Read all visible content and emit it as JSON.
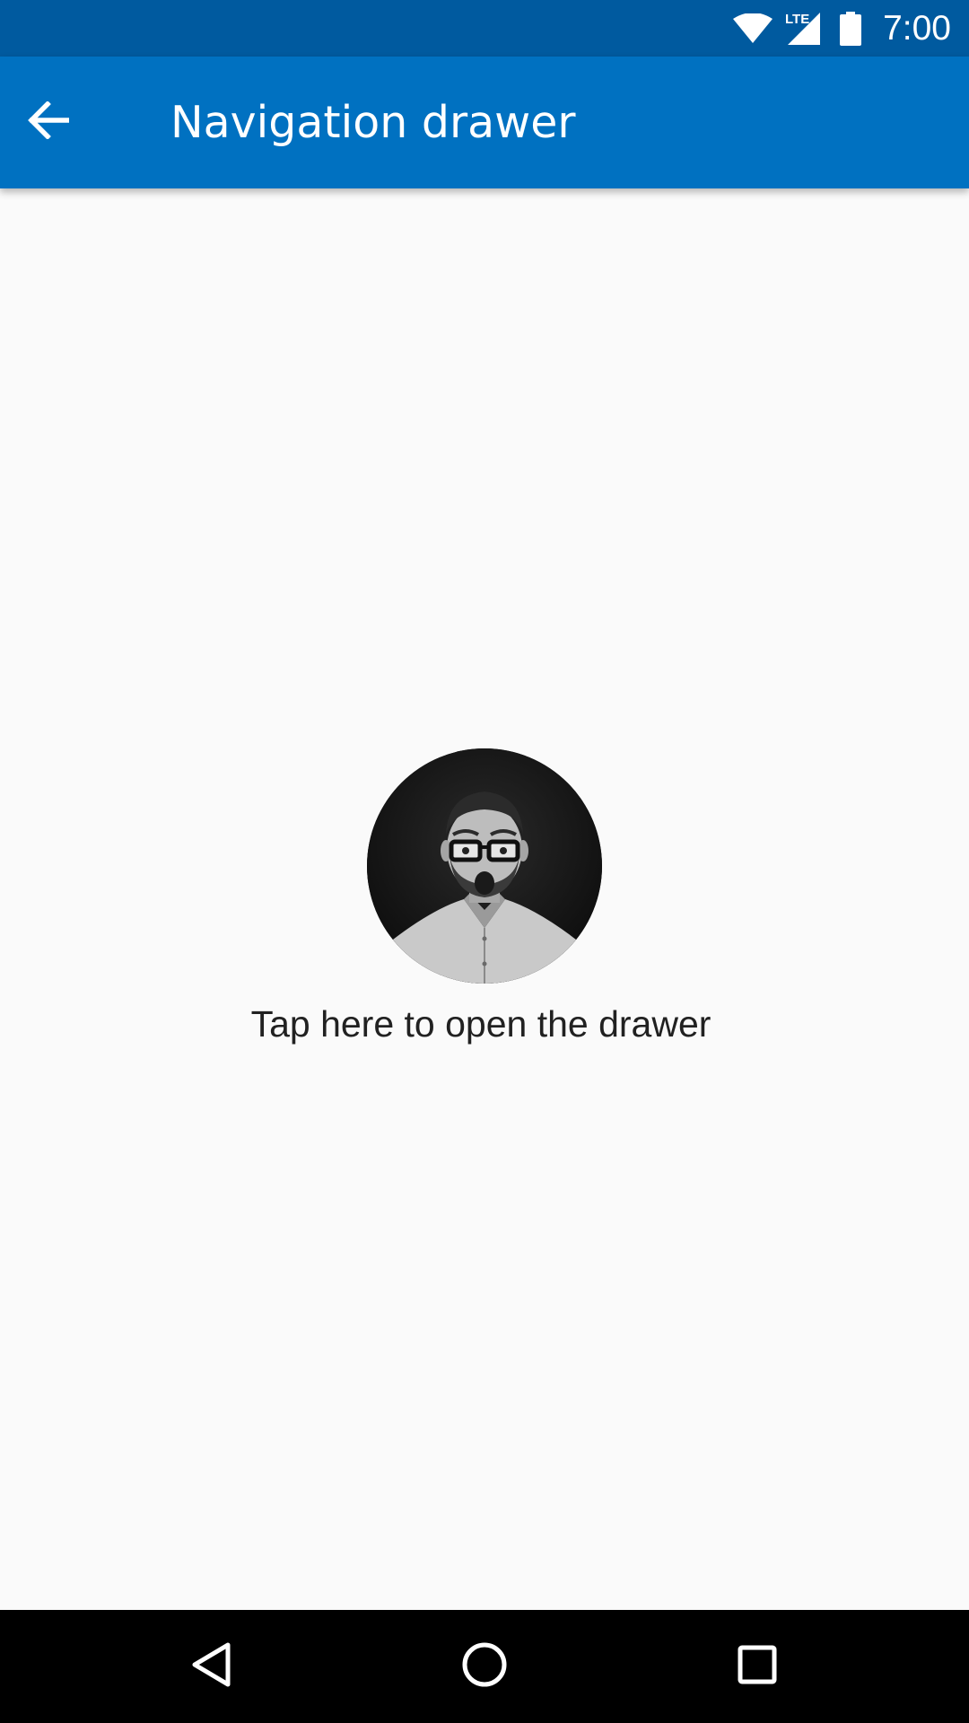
{
  "status_bar": {
    "time": "7:00",
    "network_label": "LTE",
    "icons": [
      "wifi-icon",
      "lte-signal-icon",
      "battery-icon"
    ]
  },
  "app_bar": {
    "title": "Navigation drawer",
    "back_icon": "arrow-back-icon"
  },
  "content": {
    "avatar_icon": "profile-photo",
    "tap_label": "Tap here to open the drawer"
  },
  "nav_bar": {
    "icons": [
      "nav-back-icon",
      "nav-home-icon",
      "nav-recents-icon"
    ]
  },
  "colors": {
    "status_bar": "#005a9f",
    "app_bar": "#0071c1",
    "background": "#fafafa",
    "text_primary": "#212121",
    "nav_bar": "#000000"
  }
}
